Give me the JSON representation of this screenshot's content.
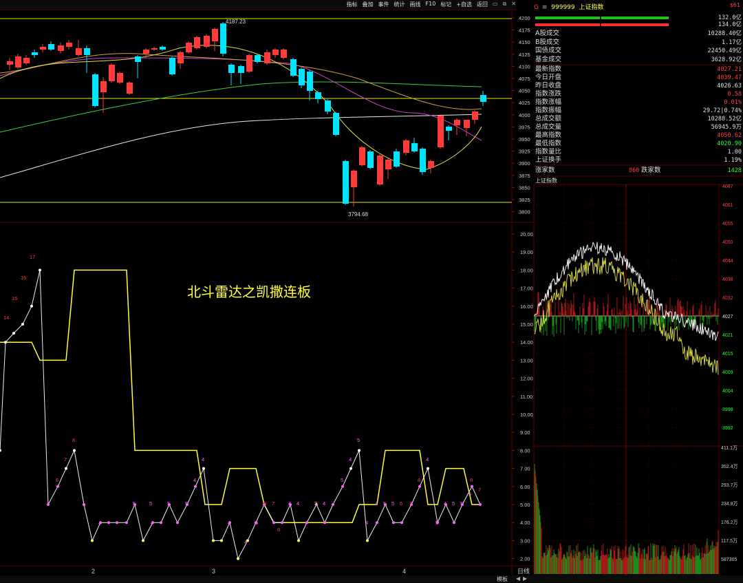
{
  "toolbar": {
    "items": [
      "指标",
      "叠加",
      "事件",
      "统计",
      "画线",
      "F10",
      "标记",
      "+自选",
      "返回"
    ],
    "window_buttons": [
      "▭",
      "⧉",
      "✕"
    ]
  },
  "main_chart": {
    "price_ticks": [
      "4200",
      "4175",
      "4150",
      "4125",
      "4100",
      "4075",
      "4050",
      "4025",
      "4000",
      "3975",
      "3950",
      "3925",
      "3900",
      "3875",
      "3850",
      "3825",
      "3800"
    ],
    "high_label": "4187.23",
    "low_label": "3794.68",
    "overlay_title": "北斗雷达之凯撒连板",
    "indicator_ticks": [
      "20.00",
      "19.00",
      "18.00",
      "17.00",
      "16.00",
      "15.00",
      "14.00",
      "13.00",
      "12.00",
      "11.00",
      "10.00",
      "9.00",
      "8.00",
      "7.00",
      "6.00",
      "5.00",
      "4.00",
      "3.00",
      "2.00"
    ],
    "indicator_point_labels": [
      "14",
      "15",
      "16",
      "17",
      "8",
      "7",
      "6",
      "4",
      "4",
      "4",
      "5",
      "4",
      "4",
      "5",
      "5",
      "6",
      "7",
      "4",
      "4",
      "3",
      "4",
      "5",
      "4",
      "5",
      "4",
      "4",
      "5",
      "5",
      "6",
      "7",
      "8",
      "4",
      "5",
      "4",
      "5",
      "5",
      "6",
      "7",
      "4",
      "5",
      "5",
      "6",
      "5"
    ],
    "x_axis_labels": [
      "2",
      "3",
      "4"
    ],
    "period_label": "日线"
  },
  "quote_panel": {
    "code": "999999",
    "name": "上证指数",
    "corner": "$61",
    "bar_vals": [
      "132.0亿",
      "134.0亿"
    ],
    "market_rows": [
      {
        "k": "A股成交",
        "v": "10288.40亿"
      },
      {
        "k": "B股成交",
        "v": "1.17亿"
      },
      {
        "k": "国债成交",
        "v": "22450.49亿"
      },
      {
        "k": "基金成交",
        "v": "3628.92亿"
      }
    ],
    "index_rows": [
      {
        "k": "最新指数",
        "v": "4027.21",
        "c": "red"
      },
      {
        "k": "今日开盘",
        "v": "4039.47",
        "c": "red"
      },
      {
        "k": "昨日收盘",
        "v": "4026.63",
        "c": "wht"
      },
      {
        "k": "指数涨跌",
        "v": "0.58",
        "c": "red"
      },
      {
        "k": "指数涨幅",
        "v": "0.01%",
        "c": "red"
      },
      {
        "k": "指数振幅",
        "v": "29.72|0.74%",
        "c": "wht"
      },
      {
        "k": "总成交额",
        "v": "10288.52亿",
        "c": "wht"
      },
      {
        "k": "总成交量",
        "v": "56945.9万",
        "c": "wht"
      },
      {
        "k": "最高指数",
        "v": "4050.62",
        "c": "red"
      },
      {
        "k": "最低指数",
        "v": "4020.90",
        "c": "grn"
      },
      {
        "k": "指数量比",
        "v": "1.00",
        "c": "wht"
      },
      {
        "k": "上证换手",
        "v": "1.19%",
        "c": "wht"
      }
    ],
    "breadth": {
      "up_label": "涨家数",
      "up": "860",
      "down_label": "跌家数",
      "down": "1428"
    }
  },
  "intraday": {
    "title": "上证指数",
    "price_ticks": [
      "4067",
      "4061",
      "4055",
      "4050",
      "4044",
      "4038",
      "4032",
      "4027",
      "4021",
      "4015",
      "4009",
      "4004",
      "3998",
      "3992"
    ],
    "vol_ticks": [
      "411.1万",
      "352.4万",
      "293.7万",
      "234.8万",
      "176.2万",
      "117.5万",
      "587305"
    ]
  },
  "bottom": {
    "left_tabs": [
      "模板"
    ],
    "right_icons": [
      "◀",
      "▶"
    ]
  },
  "colors": {
    "up": "#ff3b3b",
    "down": "#00e5ff",
    "ma_yellow": "#ffff40",
    "ma_white": "#e8e8e8",
    "grid": "#3a0000"
  }
}
